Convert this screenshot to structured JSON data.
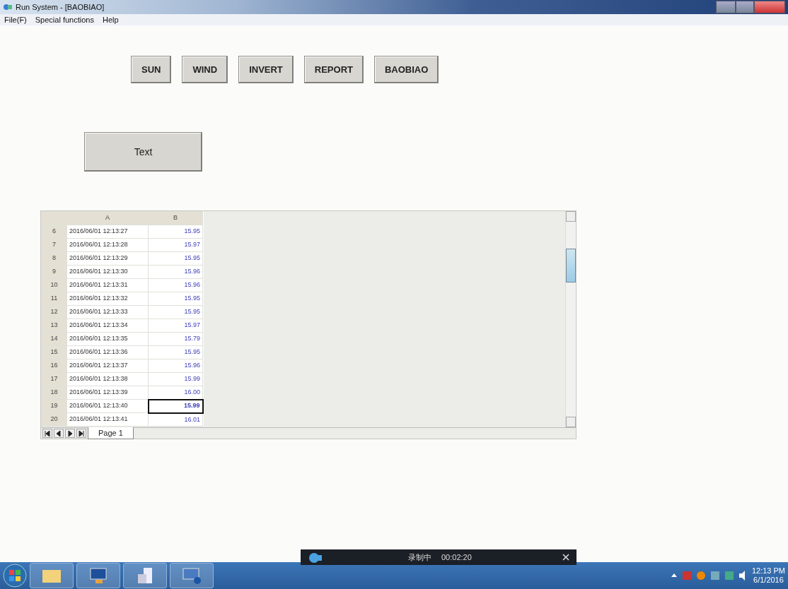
{
  "window": {
    "title": "Run System - [BAOBIAO]"
  },
  "menu": [
    "File(F)",
    "Special functions",
    "Help"
  ],
  "buttons": [
    {
      "label": "SUN"
    },
    {
      "label": "WIND"
    },
    {
      "label": "INVERT"
    },
    {
      "label": "REPORT"
    },
    {
      "label": "BAOBIAO"
    }
  ],
  "text_button": {
    "label": "Text"
  },
  "sheet": {
    "columns": [
      "A",
      "B"
    ],
    "rows": [
      {
        "num": "6",
        "a": "2016/06/01 12:13:27",
        "b": "15.95",
        "selected": false
      },
      {
        "num": "7",
        "a": "2016/06/01 12:13:28",
        "b": "15.97",
        "selected": false
      },
      {
        "num": "8",
        "a": "2016/06/01 12:13:29",
        "b": "15.95",
        "selected": false
      },
      {
        "num": "9",
        "a": "2016/06/01 12:13:30",
        "b": "15.96",
        "selected": false
      },
      {
        "num": "10",
        "a": "2016/06/01 12:13:31",
        "b": "15.96",
        "selected": false
      },
      {
        "num": "11",
        "a": "2016/06/01 12:13:32",
        "b": "15.95",
        "selected": false
      },
      {
        "num": "12",
        "a": "2016/06/01 12:13:33",
        "b": "15.95",
        "selected": false
      },
      {
        "num": "13",
        "a": "2016/06/01 12:13:34",
        "b": "15.97",
        "selected": false
      },
      {
        "num": "14",
        "a": "2016/06/01 12:13:35",
        "b": "15.79",
        "selected": false
      },
      {
        "num": "15",
        "a": "2016/06/01 12:13:36",
        "b": "15.95",
        "selected": false
      },
      {
        "num": "16",
        "a": "2016/06/01 12:13:37",
        "b": "15.96",
        "selected": false
      },
      {
        "num": "17",
        "a": "2016/06/01 12:13:38",
        "b": "15.99",
        "selected": false
      },
      {
        "num": "18",
        "a": "2016/06/01 12:13:39",
        "b": "16.00",
        "selected": false
      },
      {
        "num": "19",
        "a": "2016/06/01 12:13:40",
        "b": "15.99",
        "selected": true
      },
      {
        "num": "20",
        "a": "2016/06/01 12:13:41",
        "b": "16.01",
        "selected": false
      }
    ],
    "tabs": [
      {
        "label": "Page 1",
        "selected": true
      }
    ]
  },
  "recorder": {
    "status": "录制中",
    "time": "00:02:20"
  },
  "taskbar": {
    "clock_time": "12:13 PM",
    "clock_date": "6/1/2016"
  }
}
